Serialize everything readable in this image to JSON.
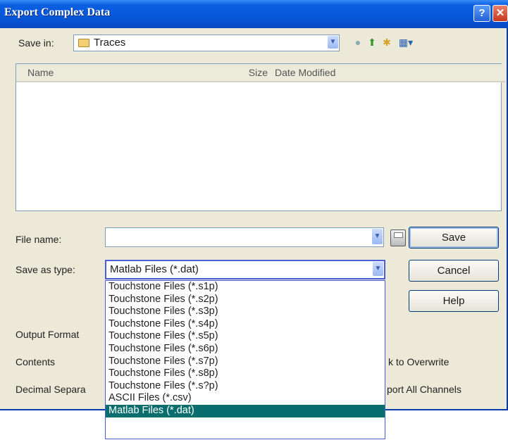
{
  "window": {
    "title": "Export Complex Data",
    "help_glyph": "?",
    "close_glyph": "✕"
  },
  "save_in": {
    "label": "Save in:",
    "value": "Traces"
  },
  "toolbar": {
    "back_icon": "back-icon",
    "up_icon": "up-folder-icon",
    "new_folder_icon": "new-folder-icon",
    "views_icon": "views-menu-icon"
  },
  "file_list": {
    "columns": [
      "Name",
      "Size",
      "Date Modified"
    ]
  },
  "file_name": {
    "label": "File name:",
    "value": ""
  },
  "save_as_type": {
    "label": "Save as type:",
    "value": "Matlab Files (*.dat)"
  },
  "buttons": {
    "save": "Save",
    "cancel": "Cancel",
    "help": "Help"
  },
  "options": {
    "output_format_label": "Output Format",
    "contents_label": "Contents",
    "decimal_separator_label": "Decimal Separa",
    "overwrite_label_partial": "k to Overwrite",
    "export_all_label_partial": "port All Channels"
  },
  "dropdown_options": [
    "Touchstone Files (*.s1p)",
    "Touchstone Files (*.s2p)",
    "Touchstone Files (*.s3p)",
    "Touchstone Files (*.s4p)",
    "Touchstone Files (*.s5p)",
    "Touchstone Files (*.s6p)",
    "Touchstone Files (*.s7p)",
    "Touchstone Files (*.s8p)",
    "Touchstone Files (*.s?p)",
    "ASCII Files (*.csv)",
    "Matlab Files (*.dat)"
  ],
  "colors": {
    "titlebar": "#0754d6",
    "dialog_bg": "#ece9d8",
    "selection": "#0a6e6e"
  }
}
